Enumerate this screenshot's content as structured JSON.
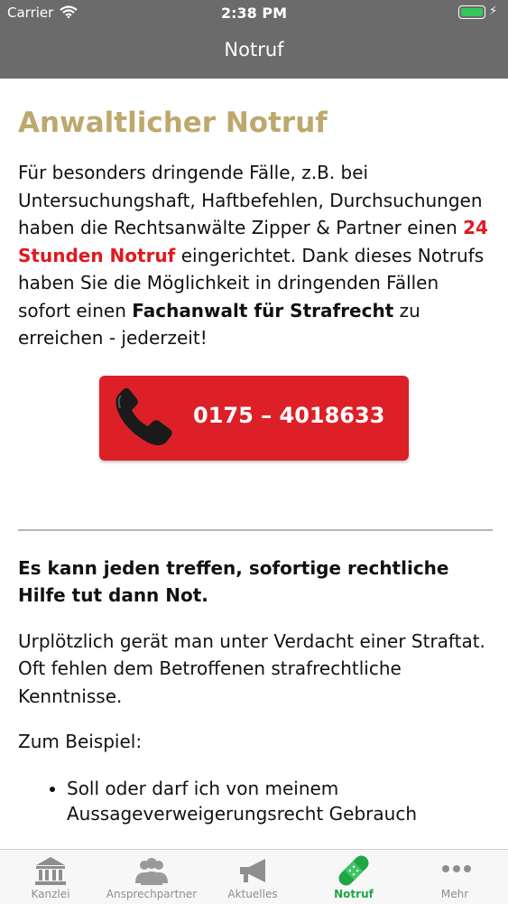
{
  "status_bar": {
    "carrier": "Carrier",
    "time": "2:38 PM"
  },
  "nav": {
    "title": "Notruf"
  },
  "content": {
    "heading": "Anwaltlicher Notruf",
    "intro_1": "Für besonders dringende Fälle, z.B. bei Untersuchungshaft, Haftbefehlen, Durchsuchungen haben die Rechtsanwälte Zipper & Partner einen ",
    "intro_red": "24 Stunden Notruf",
    "intro_2": " eingerichtet. Dank dieses Notrufs haben Sie die Möglichkeit in dringenden Fällen sofort einen ",
    "intro_bold": "Fachanwalt für Strafrecht",
    "intro_3": " zu erreichen - jederzeit!",
    "call_button": {
      "number": "0175 – 4018633"
    },
    "subheading": "Es kann jeden treffen, sofortige rechtliche Hilfe tut dann Not.",
    "para_2": "Urplötzlich gerät man unter Verdacht einer Straftat. Oft fehlen dem Betroffenen strafrechtliche Kenntnisse.",
    "para_3": "Zum Beispiel:",
    "bullets": [
      "Soll oder darf ich von meinem Aussageverweigerungsrecht Gebrauch"
    ]
  },
  "tabs": [
    {
      "label": "Kanzlei",
      "icon": "building-icon"
    },
    {
      "label": "Ansprechpartner",
      "icon": "people-icon"
    },
    {
      "label": "Aktuelles",
      "icon": "megaphone-icon"
    },
    {
      "label": "Notruf",
      "icon": "bandage-icon",
      "active": true
    },
    {
      "label": "Mehr",
      "icon": "more-icon"
    }
  ],
  "colors": {
    "accent": "#1fa745",
    "heading": "#bda86d",
    "alert": "#e1181f",
    "header": "#6b6b6b"
  }
}
